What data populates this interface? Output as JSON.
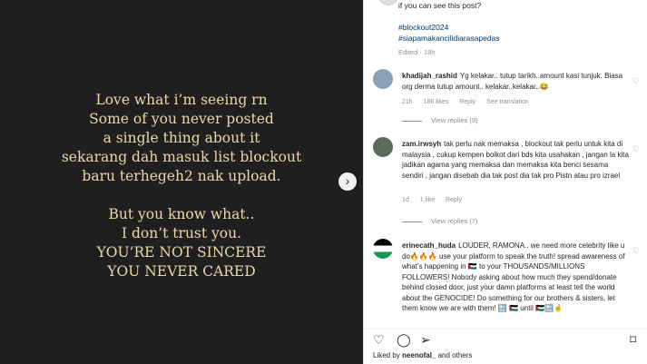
{
  "post": {
    "lines": [
      "Love what i’m seeing rn",
      "Some of you never posted",
      "a single thing about it",
      "sekarang dah masuk list blockout",
      "baru terhegeh2 nak upload.",
      "",
      "But you know what..",
      "I don’t trust you.",
      "YOU’RE NOT SINCERE",
      "YOU NEVER CARED"
    ],
    "next_icon": "chevron-right-icon"
  },
  "caption": {
    "tail": "if you can see this post?",
    "hashtag1": "#blockout2024",
    "hashtag2": "#siapamakancilidiarasapedas",
    "meta": "Edited · 18h"
  },
  "comments": [
    {
      "username": "khadijah_rashid",
      "text": "Yg kelakar.. tutup tarikh..amount kasi tunjuk. Biasa org derma tutup amount.. kelakar..kelakar..😂",
      "time": "21h",
      "likes": "186 likes",
      "reply": "Reply",
      "extra": "See translation",
      "view_replies": "View replies (9)"
    },
    {
      "username": "zam.irwsyh",
      "text": "tak perlu nak memaksa , blockout tak perlu untuk kita di malaysia , cukup kempen boikot dari bds kita usahakan , jangan la kita jadikan agama yang memaksa dan memaksa kita benci sesama sendiri , jangan disebab dia tak post dia tak pro Pistn atau pro izrael",
      "time": "1d",
      "likes": "1 like",
      "reply": "Reply",
      "extra": "",
      "view_replies": "View replies (7)"
    },
    {
      "username": "erinecath_huda",
      "text": "LOUDER, RAMONA.. we need more celebrity like u do🔥🔥🔥 use your platform to speak the truth! spread awareness of what’s happening in 🇵🇸 to your THOUSANDS/MILLIONS FOLLOWERS! Nobody asking about how much they spend/donate behind closed door, just your damn platforms at least tell the world about the GENOCIDE! Do something for our brothers & sisters, let them know we are with them! 🔚 🇵🇸 until 🇵🇸🔚🤞",
      "time": "",
      "likes": "",
      "reply": "",
      "extra": "",
      "view_replies": ""
    }
  ],
  "actions": {
    "like_icon": "heart-icon",
    "comment_icon": "comment-icon",
    "share_icon": "share-icon",
    "save_icon": "bookmark-icon"
  },
  "likes": {
    "prefix": "Liked by",
    "user": "neenofal_",
    "suffix": "and others"
  }
}
